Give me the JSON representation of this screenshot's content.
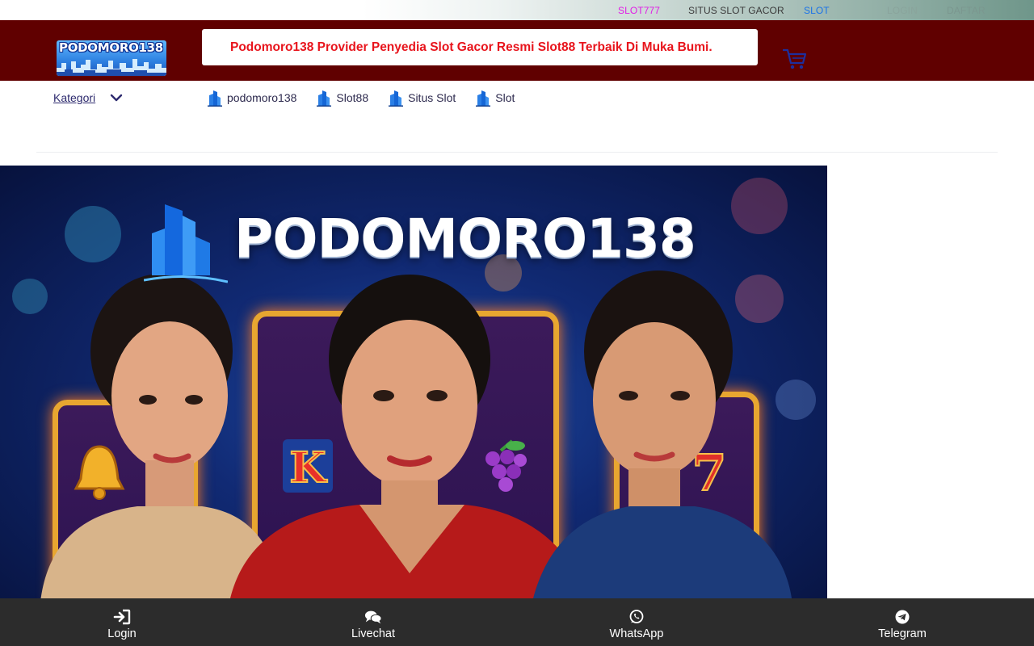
{
  "topbar": {
    "links": [
      "SLOT777",
      "SITUS SLOT GACOR",
      "SLOT",
      "LOGIN",
      "DAFTAR"
    ],
    "colors": {
      "slot777": "#e11ce6",
      "slot": "#1a73e8"
    }
  },
  "header": {
    "logo_text": "PODOMORO138",
    "marquee": "Podomoro138 Provider Penyedia Slot Gacor Resmi Slot88 Terbaik Di Muka Bumi.",
    "background": "#600000",
    "marquee_color": "#e8141c",
    "cart_icon": "cart-icon"
  },
  "nav": {
    "kategori_label": "Kategori",
    "links": [
      "podomoro138",
      "Slot88",
      "Situs Slot",
      "Slot"
    ],
    "link_icon": "building-icon"
  },
  "banner": {
    "title": "PODOMORO138"
  },
  "bottom_bar": {
    "items": [
      {
        "label": "Login",
        "icon": "login-icon"
      },
      {
        "label": "Livechat",
        "icon": "chat-icon"
      },
      {
        "label": "WhatsApp",
        "icon": "whatsapp-icon"
      },
      {
        "label": "Telegram",
        "icon": "telegram-icon"
      }
    ]
  }
}
